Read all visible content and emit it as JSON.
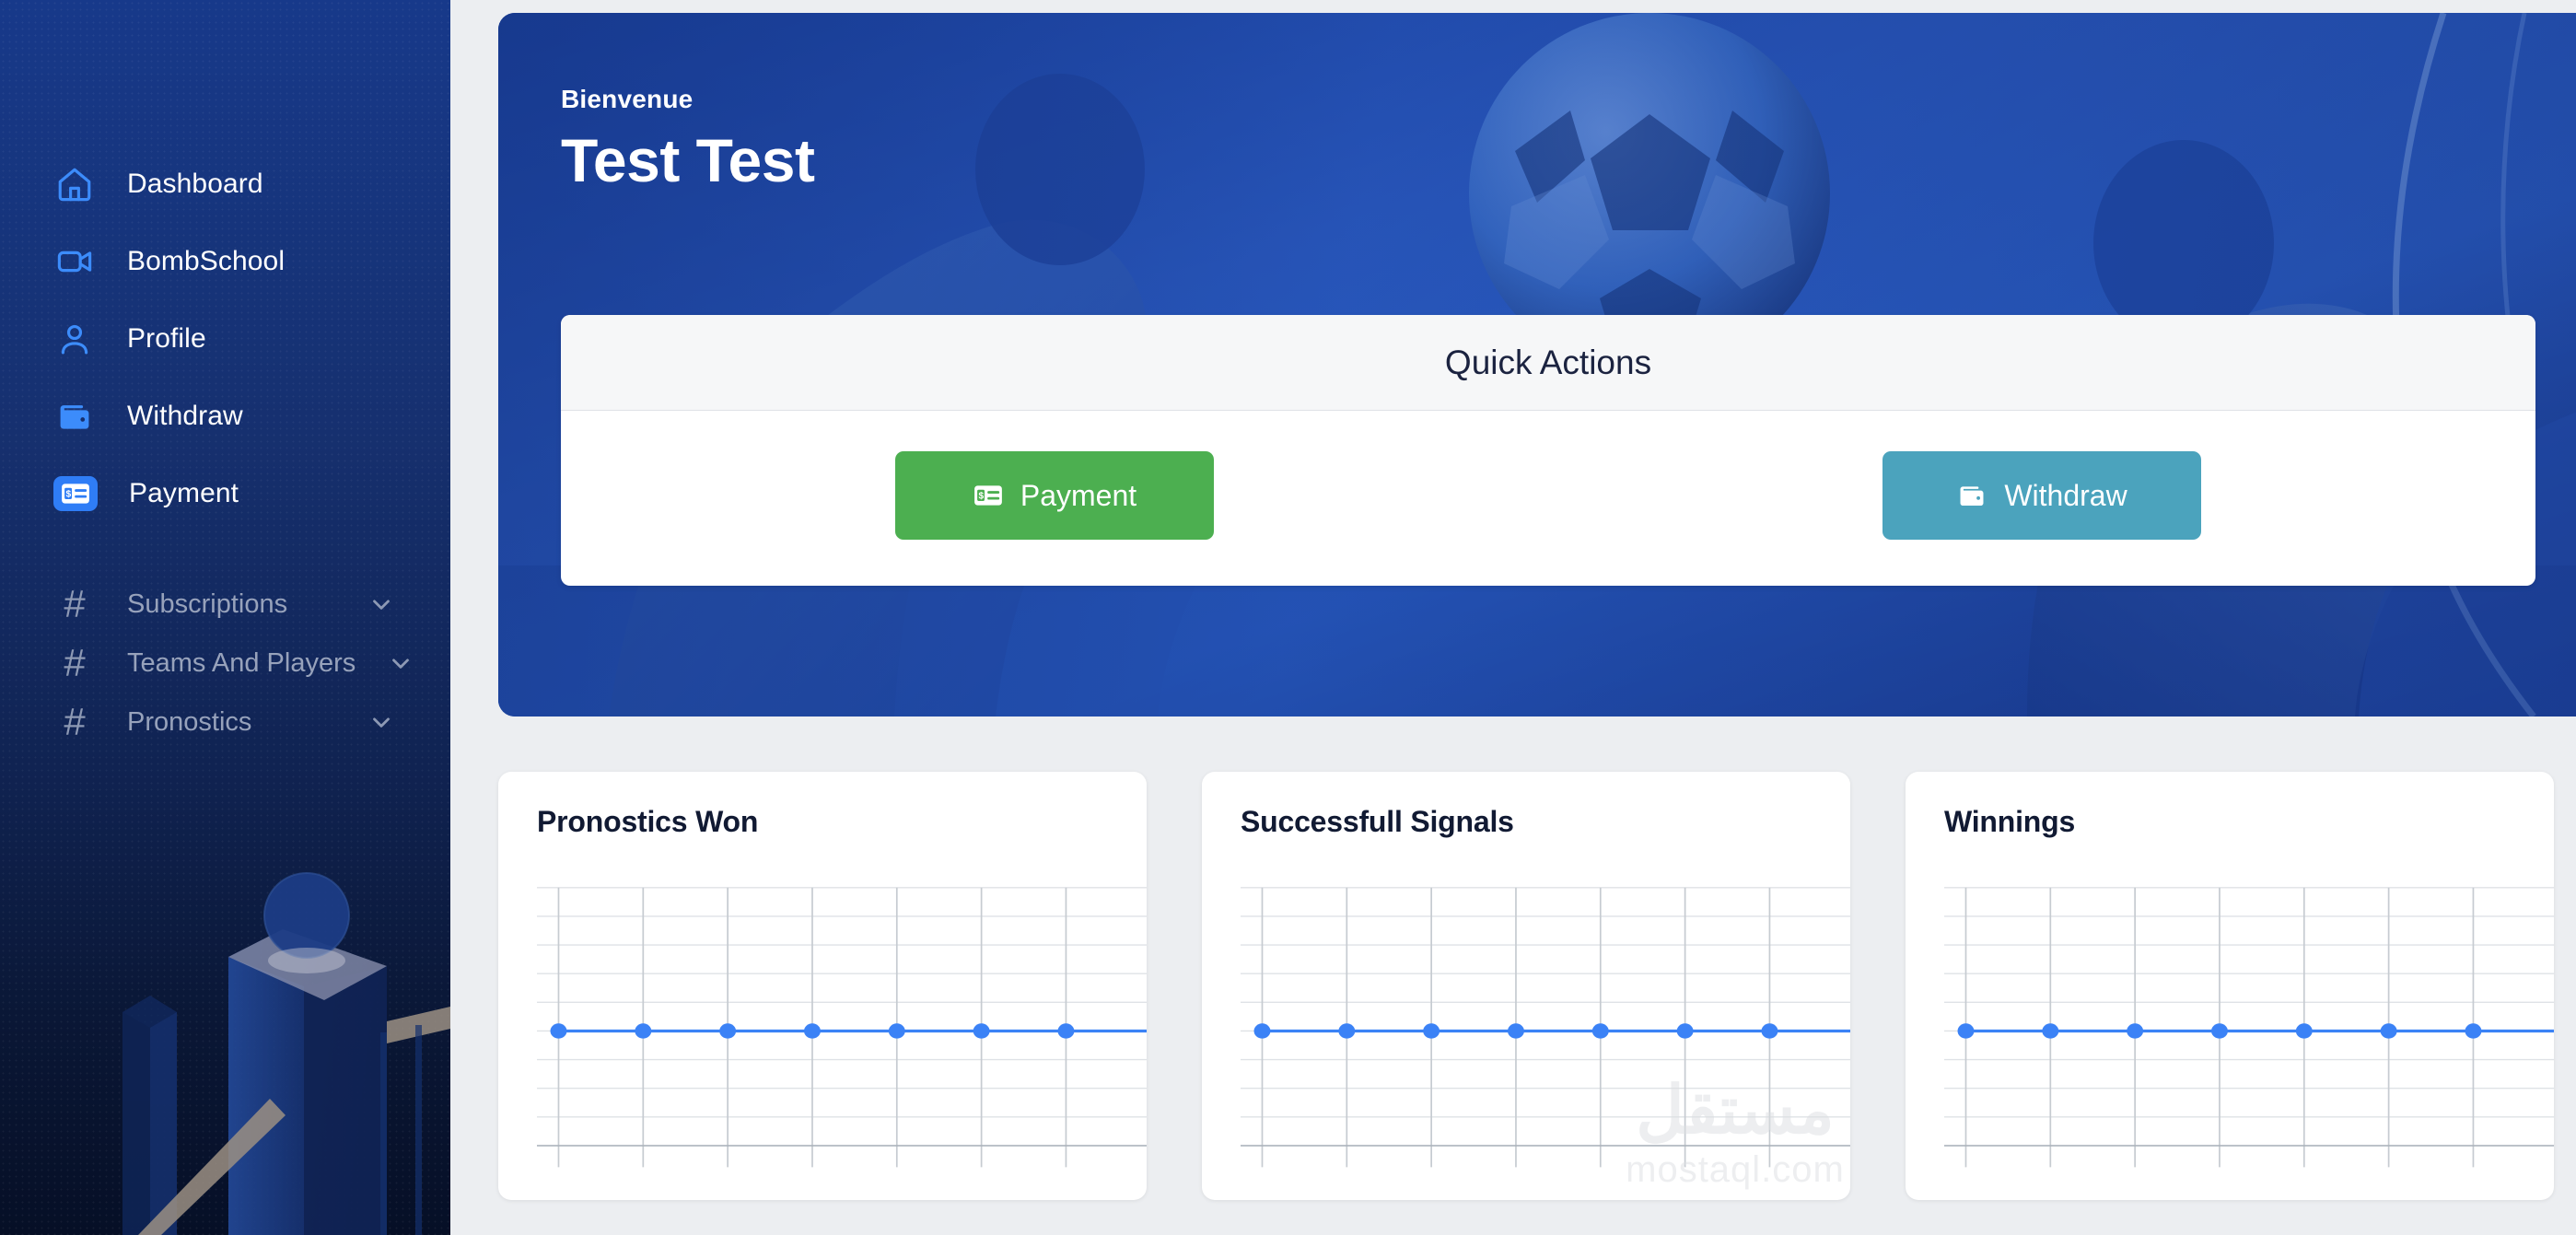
{
  "sidebar": {
    "items": [
      {
        "label": "Dashboard",
        "icon": "home-icon",
        "active": false
      },
      {
        "label": "BombSchool",
        "icon": "video-icon",
        "active": false
      },
      {
        "label": "Profile",
        "icon": "user-icon",
        "active": false
      },
      {
        "label": "Withdraw",
        "icon": "wallet-icon",
        "active": false
      },
      {
        "label": "Payment",
        "icon": "payment-card-icon",
        "active": true
      }
    ],
    "groups": [
      {
        "label": "Subscriptions",
        "icon": "hash-icon",
        "chevron": "chevron-down-icon",
        "symbol": "#"
      },
      {
        "label": "Teams And Players",
        "icon": "hash-icon",
        "chevron": "chevron-down-icon",
        "symbol": "#"
      },
      {
        "label": "Pronostics",
        "icon": "hash-icon",
        "chevron": "chevron-down-icon",
        "symbol": "#"
      }
    ],
    "illustration": "isometric-city-illustration"
  },
  "hero": {
    "welcome": "Bienvenue",
    "name": "Test Test",
    "background": "soccer-player-photo"
  },
  "quick_actions": {
    "title": "Quick Actions",
    "buttons": [
      {
        "label": "Payment",
        "icon": "payment-card-icon",
        "color": "#4caf50"
      },
      {
        "label": "Withdraw",
        "icon": "wallet-icon",
        "color": "#4ba3bd"
      }
    ]
  },
  "stat_cards": [
    {
      "title": "Pronostics Won"
    },
    {
      "title": "Successfull Signals"
    },
    {
      "title": "Winnings"
    }
  ],
  "watermark": {
    "arabic": "مستقل",
    "latin": "mostaql.com"
  },
  "colors": {
    "sidebar_top": "#17398a",
    "sidebar_bottom": "#060f26",
    "accent_blue": "#2f7df6",
    "payment_green": "#4caf50",
    "withdraw_teal": "#4ba3bd",
    "chart_line": "#3b82f6",
    "page_bg": "#eceef1"
  },
  "chart_data": [
    {
      "type": "line",
      "title": "Pronostics Won",
      "x": [
        0,
        1,
        2,
        3,
        4,
        5,
        6,
        7
      ],
      "values": [
        0,
        0,
        0,
        0,
        0,
        0,
        0,
        0
      ],
      "series": [
        {
          "name": "Pronostics Won",
          "values": [
            0,
            0,
            0,
            0,
            0,
            0,
            0,
            0
          ]
        }
      ],
      "categories": [
        "",
        "",
        "",
        "",
        "",
        "",
        "",
        ""
      ],
      "xlabel": "",
      "ylabel": "",
      "ylim": [
        0,
        10
      ],
      "grid": true,
      "legend": "none",
      "marker": "circle",
      "line_color": "#3b82f6"
    },
    {
      "type": "line",
      "title": "Successfull Signals",
      "x": [
        0,
        1,
        2,
        3,
        4,
        5,
        6,
        7
      ],
      "values": [
        0,
        0,
        0,
        0,
        0,
        0,
        0,
        0
      ],
      "series": [
        {
          "name": "Successfull Signals",
          "values": [
            0,
            0,
            0,
            0,
            0,
            0,
            0,
            0
          ]
        }
      ],
      "categories": [
        "",
        "",
        "",
        "",
        "",
        "",
        "",
        ""
      ],
      "xlabel": "",
      "ylabel": "",
      "ylim": [
        0,
        10
      ],
      "grid": true,
      "legend": "none",
      "marker": "circle",
      "line_color": "#3b82f6"
    },
    {
      "type": "line",
      "title": "Winnings",
      "x": [
        0,
        1,
        2,
        3,
        4,
        5,
        6,
        7
      ],
      "values": [
        0,
        0,
        0,
        0,
        0,
        0,
        0,
        0
      ],
      "series": [
        {
          "name": "Winnings",
          "values": [
            0,
            0,
            0,
            0,
            0,
            0,
            0,
            0
          ]
        }
      ],
      "categories": [
        "",
        "",
        "",
        "",
        "",
        "",
        "",
        ""
      ],
      "xlabel": "",
      "ylabel": "",
      "ylim": [
        0,
        10
      ],
      "grid": true,
      "legend": "none",
      "marker": "circle",
      "line_color": "#3b82f6"
    }
  ]
}
